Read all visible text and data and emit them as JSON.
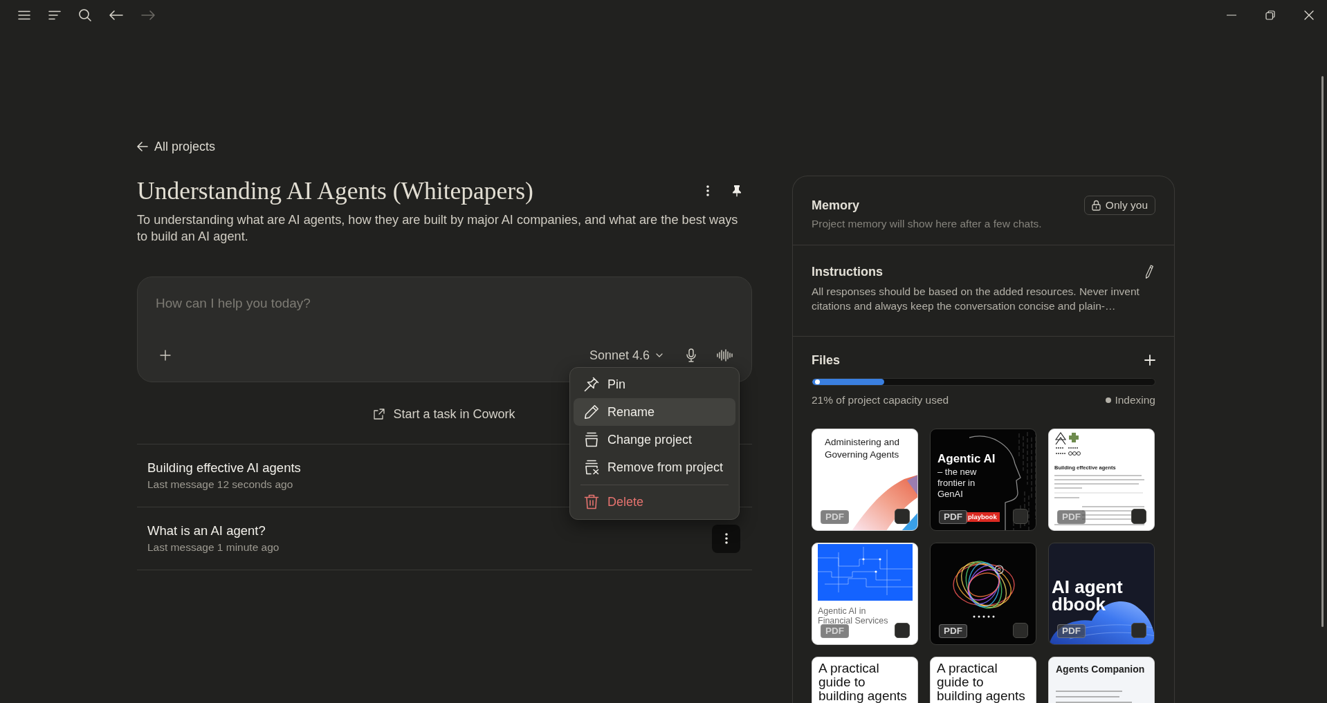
{
  "toolbar": {
    "nav": [
      {
        "kind": "back",
        "disabled": false
      },
      {
        "kind": "forward",
        "disabled": true
      }
    ]
  },
  "back_link": "All projects",
  "project": {
    "title": "Understanding AI Agents (Whitepapers)",
    "description": "To understanding what are AI agents, how they are built by major AI companies, and what are the best ways to build an AI agent."
  },
  "composer": {
    "placeholder": "How can I help you today?",
    "model": "Sonnet 4.6"
  },
  "cowork_link": "Start a task in Cowork",
  "chats": [
    {
      "title": "Building effective AI agents",
      "meta": "Last message 12 seconds ago",
      "menu_open": false
    },
    {
      "title": "What is an AI agent?",
      "meta": "Last message 1 minute ago",
      "menu_open": true
    }
  ],
  "context_menu": {
    "groups": [
      {
        "items": [
          {
            "kind": "pin",
            "label": "Pin",
            "selected": false
          },
          {
            "kind": "rename",
            "label": "Rename",
            "selected": true
          },
          {
            "kind": "move",
            "label": "Change project",
            "selected": false
          },
          {
            "kind": "remove",
            "label": "Remove from project",
            "selected": false
          }
        ]
      },
      {
        "items": [
          {
            "kind": "delete",
            "label": "Delete",
            "selected": false
          }
        ]
      }
    ]
  },
  "panel": {
    "memory": {
      "title": "Memory",
      "visibility": "Only you",
      "text": "Project memory will show here after a few chats."
    },
    "instructions": {
      "title": "Instructions",
      "text": "All responses should be based on the added resources. Never invent citations and always keep the conversation concise and plain-…"
    },
    "files": {
      "title": "Files",
      "capacity": {
        "level": 0.21,
        "label": "21% of project capacity used"
      },
      "status": "Indexing",
      "items": [
        {
          "kind": "ribbon",
          "title": "Administering and Governing Agents",
          "badge": "PDF",
          "checked": false
        },
        {
          "kind": "head",
          "title": "Agentic AI",
          "subtitle": "– the new frontier in GenAI",
          "tag": "playbook",
          "badge": "PDF",
          "checked": false
        },
        {
          "kind": "article",
          "title": "Building effective agents",
          "badge": "PDF",
          "checked": false
        },
        {
          "kind": "circuit",
          "title": "Agentic AI in Financial Services",
          "badge": "PDF",
          "checked": false
        },
        {
          "kind": "swirl",
          "badge": "PDF",
          "checked": false
        },
        {
          "kind": "blob",
          "title": "AI agent dbook",
          "badge": "PDF",
          "checked": false
        },
        {
          "kind": "plain",
          "title": "A practical guide to building agents"
        },
        {
          "kind": "plain",
          "title": "A practical guide to building agents"
        },
        {
          "kind": "companion",
          "title": "Agents Companion"
        }
      ]
    }
  }
}
